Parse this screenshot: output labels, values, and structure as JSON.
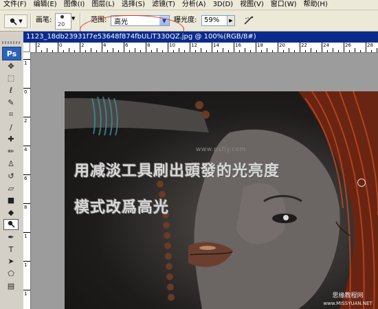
{
  "menu": {
    "items": [
      "文件(F)",
      "编辑(E)",
      "图像(I)",
      "图层(L)",
      "选择(S)",
      "滤镜(T)",
      "分析(A)",
      "3D(D)",
      "视图(V)",
      "窗口(W)",
      "帮助(H)"
    ]
  },
  "options": {
    "brush_label": "画笔:",
    "brush_size": "20",
    "range_label": "范围:",
    "range_value": "高光",
    "exposure_label": "曝光度:",
    "exposure_value": "59%"
  },
  "toolbox": {
    "logo": "Ps",
    "tools": [
      "move-tool",
      "marquee-tool",
      "lasso-tool",
      "quick-selection-tool",
      "crop-tool",
      "eyedropper-tool",
      "spot-healing-tool",
      "brush-tool",
      "clone-stamp-tool",
      "history-brush-tool",
      "eraser-tool",
      "gradient-tool",
      "blur-tool",
      "dodge-tool",
      "pen-tool",
      "type-tool",
      "path-selection-tool",
      "shape-tool",
      "notes-tool"
    ],
    "active_tool": "dodge-tool"
  },
  "document": {
    "title": "1123_18db23931f7e53648f874fbULiT330QZ.jpg @ 100%(RGB/8#)",
    "ruler_h_labels": [
      "2",
      "0",
      "2",
      "4",
      "6",
      "8",
      "10",
      "12",
      "14",
      "16",
      "18",
      "20",
      "22",
      "24",
      "26",
      "28"
    ],
    "ruler_v_labels": [
      "1",
      "0",
      "2",
      "4",
      "6",
      "8",
      "1",
      "1",
      "1"
    ]
  },
  "photo": {
    "caption_line1": "用减淡工具刷出頭發的光亮度",
    "caption_line2": "模式改爲高光",
    "watermark": "www.psfly.com",
    "corner_logo_line1": "思缘教程网",
    "corner_logo_line2": "www.MISSYUAN.NET"
  },
  "colors": {
    "menubar_bg": "#ece9d8",
    "title_bar": "#0b2a8c",
    "highlight_annotation": "#c43b2c"
  }
}
